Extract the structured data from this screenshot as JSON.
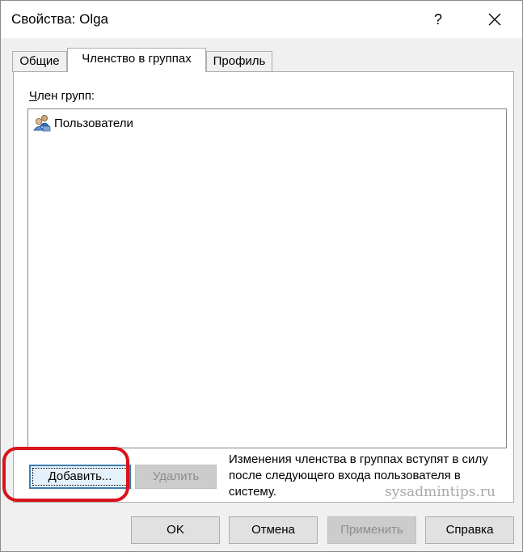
{
  "window": {
    "title": "Свойства: Olga",
    "help_glyph": "?",
    "close_glyph": "✕"
  },
  "tabs": [
    {
      "label": "Общие",
      "active": false
    },
    {
      "label": "Членство в группах",
      "active": true
    },
    {
      "label": "Профиль",
      "active": false
    }
  ],
  "membership": {
    "label_ul": "Ч",
    "label_rest": "лен групп:",
    "groups": [
      {
        "name": "Пользователи",
        "icon": "users-group-icon"
      }
    ],
    "add_label": "Добавить...",
    "remove_label": "Удалить",
    "info_text": "Изменения членства в группах вступят в силу после следующего входа пользователя в систему."
  },
  "watermark": "sysadmintips.ru",
  "footer": {
    "ok_label": "OK",
    "cancel_label": "Отмена",
    "apply_label": "Применить",
    "help_label": "Справка"
  },
  "colors": {
    "highlight": "#d9131c",
    "dialog_bg": "#f0f0f0",
    "focus_border": "#3c7fb1"
  }
}
